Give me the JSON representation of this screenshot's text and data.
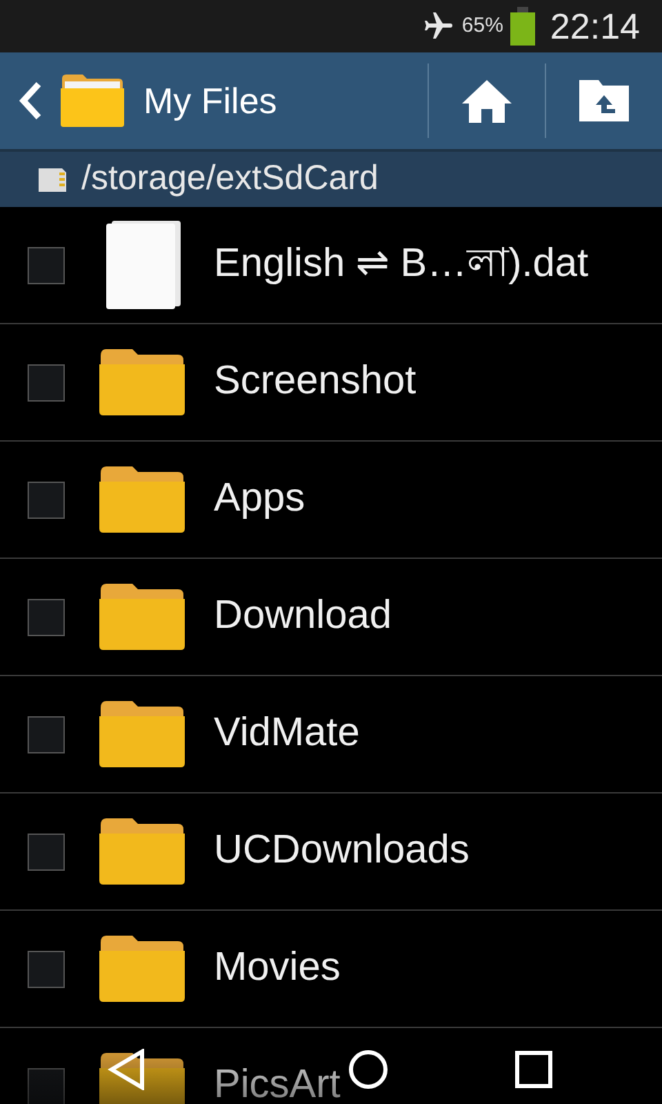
{
  "status_bar": {
    "battery_text": "65%",
    "time": "22:14"
  },
  "action_bar": {
    "title": "My Files"
  },
  "path_bar": {
    "path": "/storage/extSdCard"
  },
  "files": [
    {
      "kind": "file",
      "name": "English ⇌ B…লা).dat",
      "checked": false
    },
    {
      "kind": "folder",
      "name": "Screenshot",
      "checked": false
    },
    {
      "kind": "folder",
      "name": "Apps",
      "checked": false
    },
    {
      "kind": "folder",
      "name": "Download",
      "checked": false
    },
    {
      "kind": "folder",
      "name": "VidMate",
      "checked": false
    },
    {
      "kind": "folder",
      "name": "UCDownloads",
      "checked": false
    },
    {
      "kind": "folder",
      "name": "Movies",
      "checked": false
    },
    {
      "kind": "folder",
      "name": "PicsArt",
      "checked": false
    }
  ]
}
